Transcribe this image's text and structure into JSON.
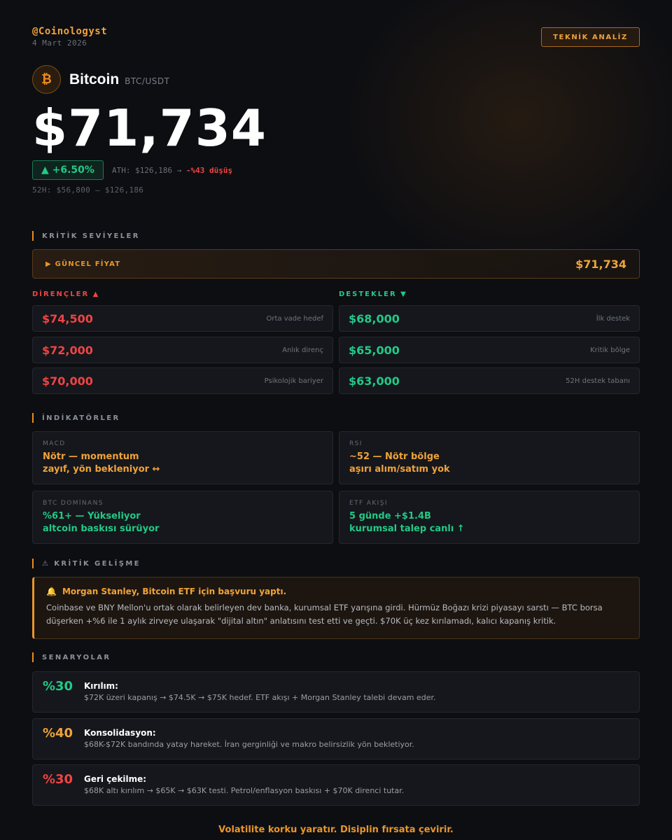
{
  "header": {
    "handle": "@Coinologyst",
    "date": "4 Mart 2026",
    "tag": "TEKNİK ANALİZ"
  },
  "coin": {
    "icon": "bitcoin-icon",
    "symbol": "₿",
    "name": "Bitcoin",
    "pair": "BTC/USDT",
    "price": "$71,734",
    "change": "▲ +6.50%",
    "ath_prefix": "ATH: $126,186 →",
    "ath_drop": "-%43 düşüş",
    "range_52w": "52H: $56,800 – $126,186"
  },
  "levels": {
    "heading": "KRİTİK SEVİYELER",
    "current_label": "▶ GÜNCEL FİYAT",
    "current_value": "$71,734",
    "resistance_title": "DİRENÇLER ▲",
    "support_title": "DESTEKLER ▼",
    "resistances": [
      {
        "value": "$74,500",
        "note": "Orta vade hedef"
      },
      {
        "value": "$72,000",
        "note": "Anlık direnç"
      },
      {
        "value": "$70,000",
        "note": "Psikolojik bariyer"
      }
    ],
    "supports": [
      {
        "value": "$68,000",
        "note": "İlk destek"
      },
      {
        "value": "$65,000",
        "note": "Kritik bölge"
      },
      {
        "value": "$63,000",
        "note": "52H destek tabanı"
      }
    ]
  },
  "indicators": {
    "heading": "İNDİKATÖRLER",
    "items": [
      {
        "label": "MACD",
        "text": "Nötr — momentum\nzayıf, yön bekleniyor ↔",
        "color": "#f0a33a"
      },
      {
        "label": "RSI",
        "text": "~52 — Nötr bölge\naşırı alım/satım yok",
        "color": "#f0a33a"
      },
      {
        "label": "BTC DOMİNANS",
        "text": "%61+ — Yükseliyor\naltcoin baskısı sürüyor",
        "color": "#22c987"
      },
      {
        "label": "ETF AKIŞI",
        "text": "5 günde +$1.4B\nkurumsal talep canlı ↑",
        "color": "#22c987"
      }
    ]
  },
  "news": {
    "heading": "⚠ KRİTİK GELİŞME",
    "icon": "bell-icon",
    "title": "Morgan Stanley, Bitcoin ETF için başvuru yaptı.",
    "body": "Coinbase ve BNY Mellon'u ortak olarak belirleyen dev banka, kurumsal ETF yarışına girdi. Hürmüz Boğazı krizi piyasayı sarstı — BTC borsa düşerken +%6 ile 1 aylık zirveye ulaşarak \"dijital altın\" anlatısını test etti ve geçti. $70K üç kez kırılamadı, kalıcı kapanış kritik."
  },
  "scenarios": {
    "heading": "SENARYOLAR",
    "items": [
      {
        "pct": "%30",
        "title": "Kırılım:",
        "desc": "$72K üzeri kapanış → $74.5K → $75K hedef. ETF akışı + Morgan Stanley talebi devam eder.",
        "color": "#22c987"
      },
      {
        "pct": "%40",
        "title": "Konsolidasyon:",
        "desc": "$68K-$72K bandında yatay hareket. İran gerginliği ve makro belirsizlik yön bekletiyor.",
        "color": "#f0a33a"
      },
      {
        "pct": "%30",
        "title": "Geri çekilme:",
        "desc": "$68K altı kırılım → $65K → $63K testi. Petrol/enflasyon baskısı + $70K direnci tutar.",
        "color": "#ef4444"
      }
    ]
  },
  "footer": "Volatilite korku yaratır. Disiplin fırsata çevirir."
}
